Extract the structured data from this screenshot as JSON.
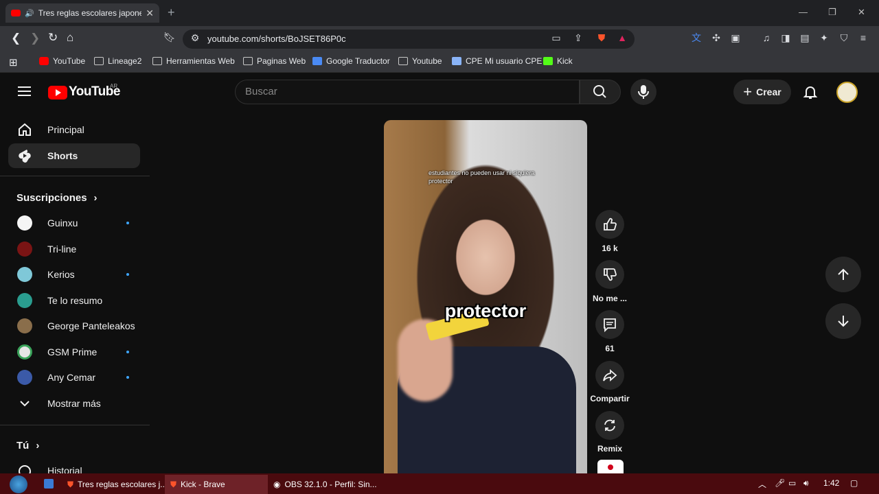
{
  "browser": {
    "tab_title": "Tres reglas escolares japonesas",
    "url": "youtube.com/shorts/BoJSET86P0c",
    "bookmarks": [
      "YouTube",
      "Lineage2",
      "Herramientas Web",
      "Paginas Web",
      "Google Traductor",
      "Youtube",
      "CPE Mi usuario CPE",
      "Kick"
    ]
  },
  "header": {
    "logo": "YouTube",
    "country": "AR",
    "search_placeholder": "Buscar",
    "create_label": "Crear"
  },
  "sidebar": {
    "main": [
      {
        "label": "Principal",
        "icon": "home-icon"
      },
      {
        "label": "Shorts",
        "icon": "shorts-icon",
        "active": true
      }
    ],
    "subscriptions_title": "Suscripciones",
    "channels": [
      {
        "name": "Guinxu",
        "dot": true,
        "color": "#f5f5f5"
      },
      {
        "name": "Tri-line",
        "dot": false,
        "color": "#7a1414"
      },
      {
        "name": "Kerios",
        "dot": true,
        "color": "#7fc8d8"
      },
      {
        "name": "Te lo resumo",
        "dot": false,
        "color": "#2a9d8f"
      },
      {
        "name": "George Panteleakos",
        "dot": false,
        "color": "#8a6e4b"
      },
      {
        "name": "GSM Prime",
        "dot": true,
        "color": "#e5e5e5"
      },
      {
        "name": "Any Cemar",
        "dot": true,
        "color": "#3b5aa8"
      }
    ],
    "show_more": "Mostrar más",
    "you_title": "Tú",
    "history": "Historial"
  },
  "video": {
    "caption_top": "estudiantes no pueden usar ni siquiera protector",
    "caption_main": "protector"
  },
  "actions": {
    "likes": "16 k",
    "dislike": "No me ...",
    "comments": "61",
    "share": "Compartir",
    "remix": "Remix"
  },
  "taskbar": {
    "items": [
      "Tres reglas escolares j...",
      "Kick - Brave",
      "OBS 32.1.0 - Perfil: Sin..."
    ],
    "time": "1:42"
  },
  "colors": {
    "accent": "#ff0000",
    "subscription_dot": "#3ea6ff",
    "taskbar": "#4a0a0e"
  }
}
